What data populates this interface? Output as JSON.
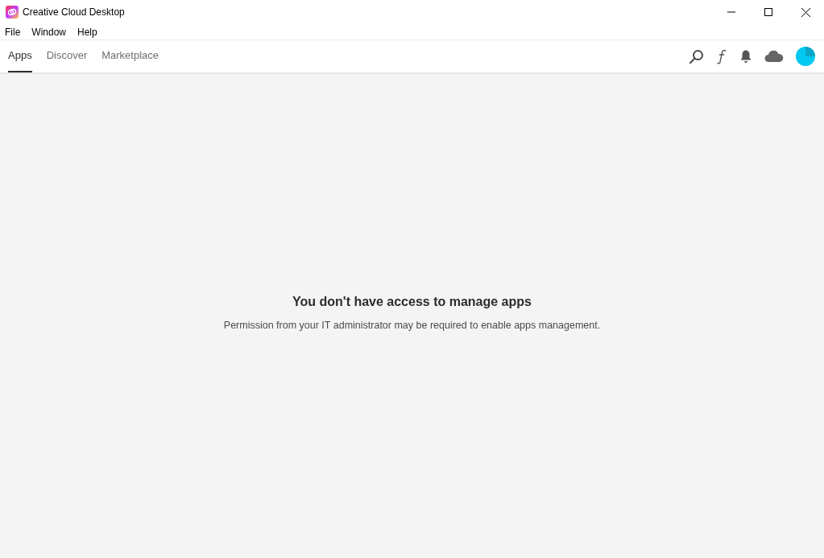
{
  "window": {
    "title": "Creative Cloud Desktop"
  },
  "menu": [
    "File",
    "Window",
    "Help"
  ],
  "tabs": [
    {
      "label": "Apps",
      "selected": true
    },
    {
      "label": "Discover",
      "selected": false
    },
    {
      "label": "Marketplace",
      "selected": false
    }
  ],
  "message": {
    "title": "You don't have access to manage apps",
    "body": "Permission from your IT administrator may be required to enable apps management."
  }
}
